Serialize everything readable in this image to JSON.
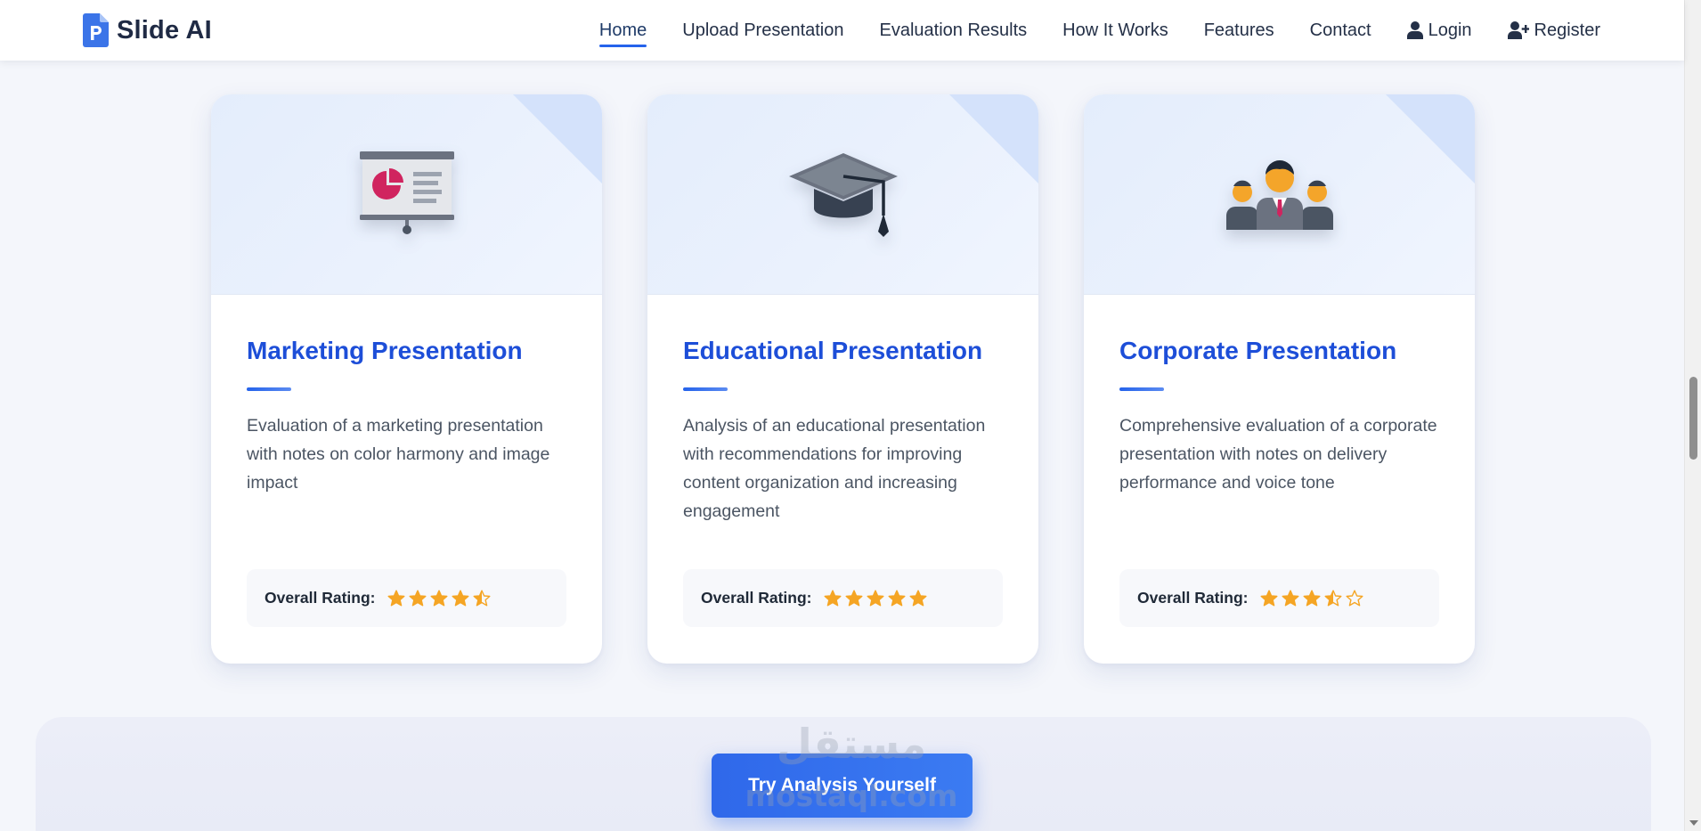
{
  "brand": {
    "name": "Slide AI",
    "icon": "powerpoint-file-icon"
  },
  "nav": {
    "items": [
      {
        "label": "Home",
        "active": true
      },
      {
        "label": "Upload Presentation"
      },
      {
        "label": "Evaluation Results"
      },
      {
        "label": "How It Works"
      },
      {
        "label": "Features"
      },
      {
        "label": "Contact"
      },
      {
        "label": "Login",
        "icon": "user-icon"
      },
      {
        "label": "Register",
        "icon": "user-plus-icon"
      }
    ]
  },
  "cards": [
    {
      "title": "Marketing Presentation",
      "description": "Evaluation of a marketing presentation with notes on color harmony and image impact",
      "rating_label": "Overall Rating:",
      "rating": 4.5,
      "icon": "presentation-board-icon"
    },
    {
      "title": "Educational Presentation",
      "description": "Analysis of an educational presentation with recommendations for improving content organization and increasing engagement",
      "rating_label": "Overall Rating:",
      "rating": 5,
      "icon": "graduation-cap-icon"
    },
    {
      "title": "Corporate Presentation",
      "description": "Comprehensive evaluation of a corporate presentation with notes on delivery performance and voice tone",
      "rating_label": "Overall Rating:",
      "rating": 3.5,
      "icon": "business-team-icon"
    }
  ],
  "cta": {
    "label": "Try Analysis Yourself"
  },
  "watermark": {
    "arabic": "مستقل",
    "latin": "mostaql.com"
  },
  "colors": {
    "accent": "#2563eb",
    "title": "#1d4ed8",
    "star": "#f5a524",
    "text": "#4b5563"
  }
}
